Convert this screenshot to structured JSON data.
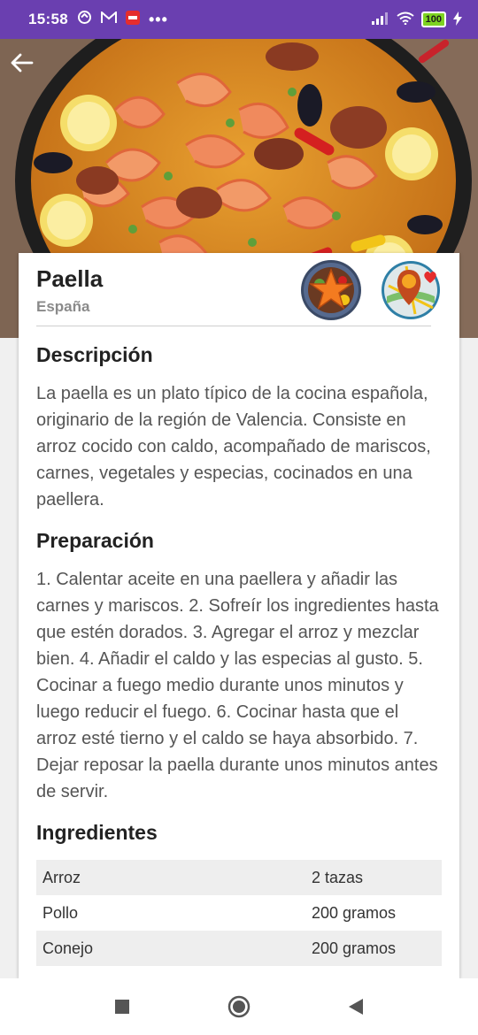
{
  "status_bar": {
    "time": "15:58",
    "battery": "100",
    "icons": [
      "sync-icon",
      "gmail-icon",
      "club-app-icon",
      "more-dots-icon",
      "signal-icon",
      "wifi-icon",
      "battery-icon",
      "charging-icon"
    ]
  },
  "hero": {
    "image": "paella-photo"
  },
  "recipe": {
    "title": "Paella",
    "country": "España",
    "favorite_icon": "star-dish-icon",
    "map_icon": "map-pin-heart-icon"
  },
  "sections": {
    "description_heading": "Descripción",
    "description_text": "La paella es un plato típico de la cocina española, originario de la región de Valencia. Consiste en arroz cocido con caldo, acompañado de mariscos, carnes, vegetales y especias, cocinados en una paellera.",
    "preparation_heading": "Preparación",
    "preparation_text": "1. Calentar aceite en una paellera y añadir las carnes y mariscos. 2. Sofreír los ingredientes hasta que estén dorados. 3. Agregar el arroz y mezclar bien. 4. Añadir el caldo y las especias al gusto. 5. Cocinar a fuego medio durante unos minutos y luego reducir el fuego. 6. Cocinar hasta que el arroz esté tierno y el caldo se haya absorbido. 7. Dejar reposar la paella durante unos minutos antes de servir.",
    "ingredients_heading": "Ingredientes"
  },
  "ingredients": [
    {
      "name": "Arroz",
      "qty": "2 tazas"
    },
    {
      "name": "Pollo",
      "qty": "200 gramos"
    },
    {
      "name": "Conejo",
      "qty": "200 gramos"
    }
  ],
  "colors": {
    "status_bar": "#6a3fb0",
    "card_bg": "#ffffff",
    "heading": "#222222",
    "body_text": "#555555",
    "muted": "#8a8a8a"
  }
}
